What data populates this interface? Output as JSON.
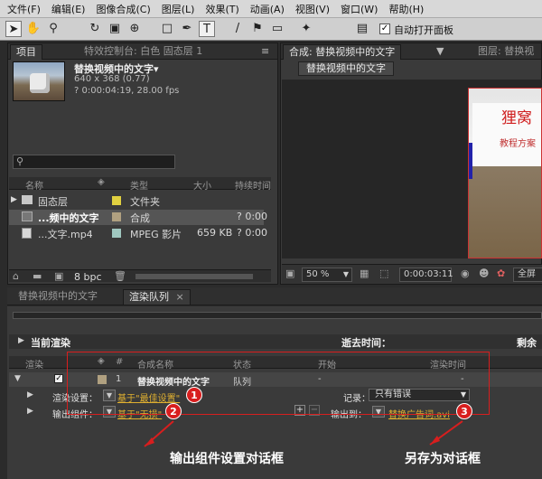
{
  "menu": [
    "文件(F)",
    "编辑(E)",
    "图像合成(C)",
    "图层(L)",
    "效果(T)",
    "动画(A)",
    "视图(V)",
    "窗口(W)",
    "帮助(H)"
  ],
  "toolbar": {
    "auto_open_label": "自动打开面板",
    "auto_open_checked": true
  },
  "project_panel": {
    "tab_project": "项目",
    "tab_effects": "特效控制台: 白色 固态层 1",
    "preview": {
      "name": "替换视频中的文字▾",
      "size": "640 x 368 (0.77)",
      "duration": "? 0:00:04:19, 28.00 fps"
    },
    "columns": {
      "name": "名称",
      "type": "类型",
      "size": "大小",
      "duration": "持续时间"
    },
    "items": [
      {
        "name": "固态层",
        "color": "#e0d040",
        "type": "文件夹",
        "size": "",
        "duration": ""
      },
      {
        "name": "...频中的文字",
        "color": "#b0a080",
        "type": "合成",
        "size": "",
        "duration": "? 0:00"
      },
      {
        "name": "...文字.mp4",
        "color": "#a0c8c0",
        "type": "MPEG 影片",
        "size": "659 KB",
        "duration": "? 0:00"
      }
    ],
    "bpc": "8 bpc"
  },
  "composition_panel": {
    "tab_comp": "合成: 替换视频中的文字",
    "tab_layer": "图层: 替换视",
    "subtab": "替换视频中的文字",
    "zoom": "50 %",
    "timecode": "0:00:03:11",
    "resolution": "全屏",
    "frame_title": "狸窝",
    "frame_subtitle": "教程方案"
  },
  "bottom_tabs": {
    "timeline": "替换视频中的文字",
    "render_queue": "渲染队列"
  },
  "render_queue": {
    "current_render_label": "当前渲染",
    "elapsed_label": "逝去时间：",
    "remaining_label": "剩余",
    "columns": {
      "render": "渲染",
      "num": "#",
      "comp": "合成名称",
      "status": "状态",
      "start": "开始",
      "render_time": "渲染时间"
    },
    "item": {
      "number": "1",
      "comp_name": "替换视频中的文字",
      "status": "队列",
      "start": "-",
      "render_time": "-"
    },
    "render_settings_label": "渲染设置：",
    "render_settings_value": "基于\"最佳设置\"",
    "log_label": "记录：",
    "log_value": "只有错误",
    "output_module_label": "输出组件：",
    "output_module_value": "基于\"无损\"",
    "output_to_label": "输出到：",
    "output_to_value": "替换广告词.avi"
  },
  "annotations": {
    "badges": [
      "1",
      "2",
      "3"
    ],
    "label_output_module": "输出组件设置对话框",
    "label_save_as": "另存为对话框",
    "color": "#d81e1e"
  }
}
